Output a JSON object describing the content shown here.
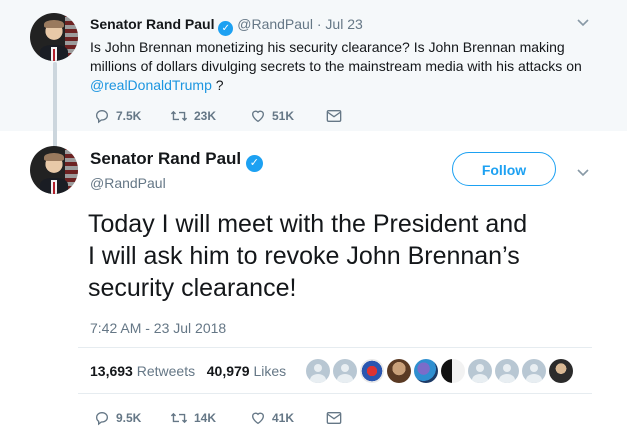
{
  "parent_tweet": {
    "display_name": "Senator Rand Paul",
    "handle": "@RandPaul",
    "separator": "·",
    "date": "Jul 23",
    "text_line1": "Is John Brennan monetizing his security clearance?  Is John Brennan making",
    "text_line2": "millions of dollars divulging secrets to the mainstream media with his attacks on",
    "mention": "@realDonaldTrump",
    "text_end": " ?",
    "replies": "7.5K",
    "retweets": "23K",
    "likes": "51K"
  },
  "main_tweet": {
    "display_name": "Senator Rand Paul",
    "handle": "@RandPaul",
    "follow_label": "Follow",
    "text_line1": "Today I will meet with the President and",
    "text_line2": "I will ask him to revoke John Brennan’s",
    "text_line3": "security clearance!",
    "timestamp": "7:42 AM - 23 Jul 2018",
    "retweet_count": "13,693",
    "retweet_label": "Retweets",
    "like_count": "40,979",
    "like_label": "Likes",
    "replies": "9.5K",
    "retweets": "14K",
    "likes": "41K"
  },
  "icons": [
    "reply-icon",
    "retweet-icon",
    "like-icon",
    "message-icon",
    "verified-icon",
    "chevron-down-icon"
  ],
  "colors": {
    "accent": "#1da1f2",
    "link": "#1b95e0",
    "muted": "#657786",
    "parent_bg": "#f5f8fa"
  }
}
